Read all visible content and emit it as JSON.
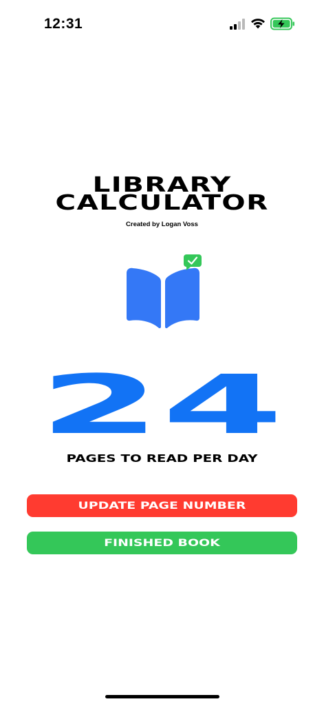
{
  "status_bar": {
    "time": "12:31"
  },
  "app": {
    "title_line1": "LIBRARY",
    "title_line2": "CALCULATOR",
    "credit": "Created by Logan Voss"
  },
  "reading": {
    "pages_per_day": "24",
    "pages_label": "PAGES TO READ PER DAY"
  },
  "actions": {
    "update_label": "UPDATE PAGE NUMBER",
    "finished_label": "FINISHED BOOK"
  },
  "icons": {
    "book": "open-book-with-check-icon",
    "signal": "cellular-signal-icon",
    "wifi": "wifi-icon",
    "battery": "battery-charging-icon"
  },
  "colors": {
    "accent_blue": "#1273f5",
    "book_blue": "#3478f6",
    "update_red": "#ff3b30",
    "finished_green": "#34c759",
    "check_green": "#34c759"
  }
}
